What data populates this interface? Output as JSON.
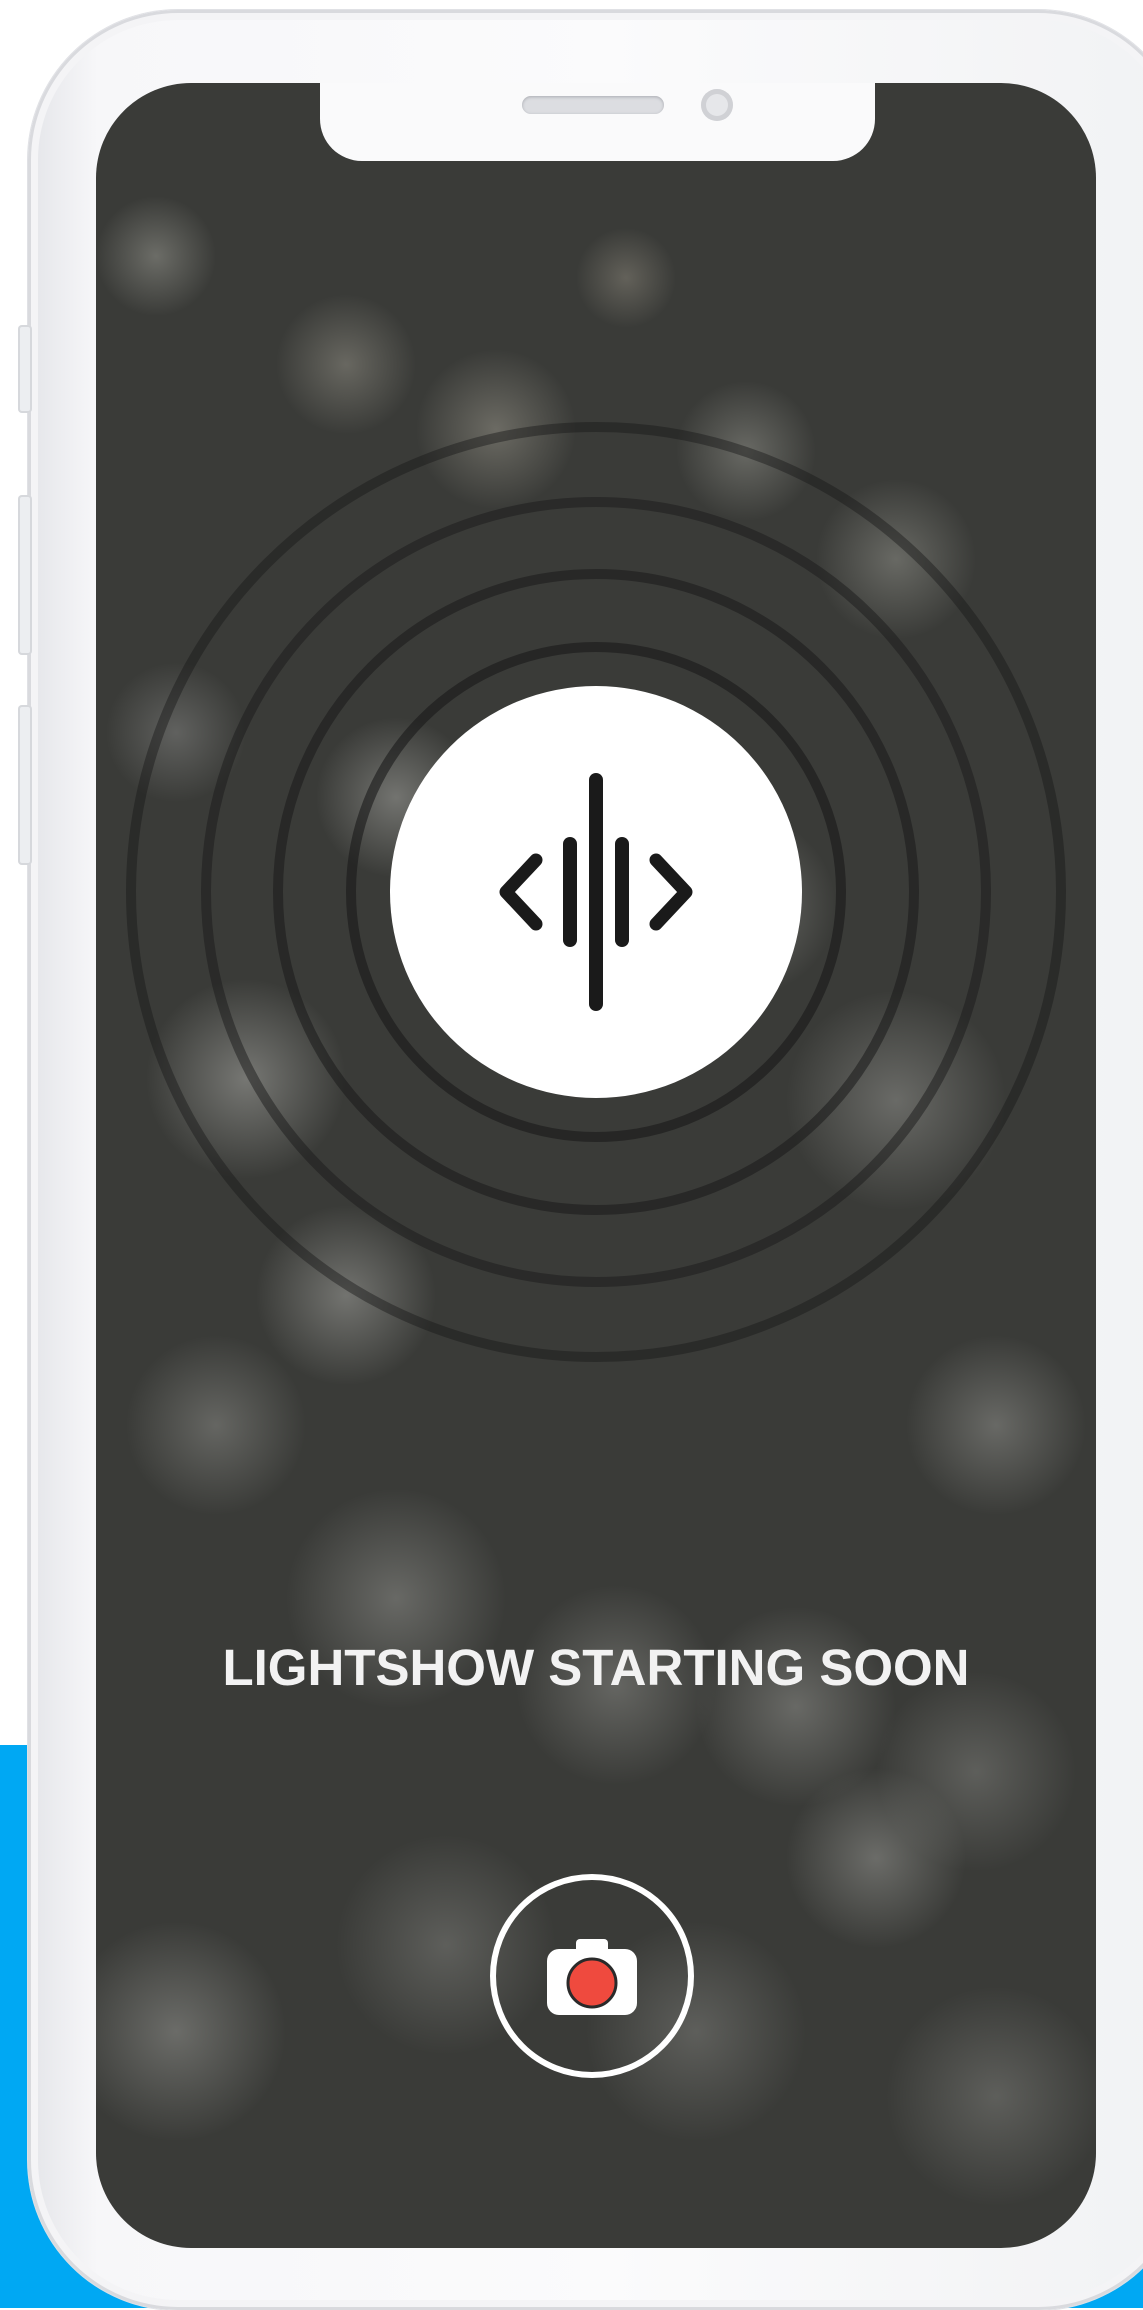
{
  "screen": {
    "status_text": "LIGHTSHOW STARTING SOON"
  },
  "icons": {
    "center": "audio-wave-icon",
    "camera": "camera-icon"
  },
  "colors": {
    "background_accent": "#00a8f3",
    "record_dot": "#ef4a3e",
    "screen_bg": "#3a3b38"
  }
}
